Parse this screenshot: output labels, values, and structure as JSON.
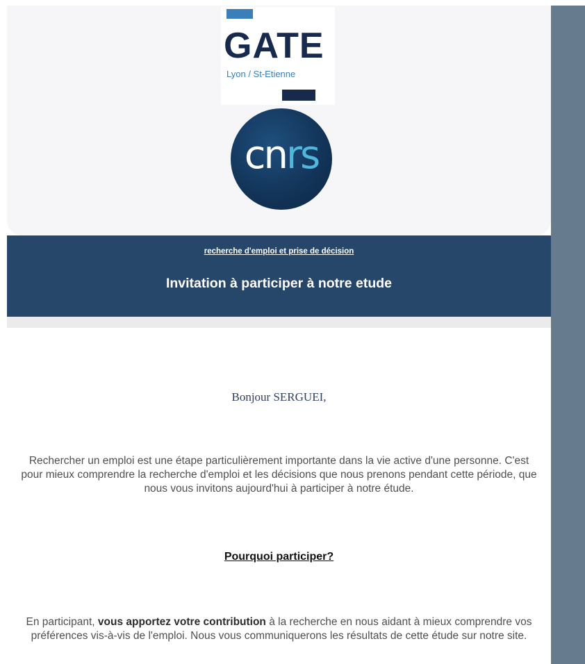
{
  "logos": {
    "gate_word": "GATE",
    "gate_subtitle": "Lyon / St-Etienne",
    "cnrs_part1": "cn",
    "cnrs_part2": "rs"
  },
  "banner": {
    "link_text": "recherche d'emploi et prise de décision",
    "title": "Invitation à participer à notre etude"
  },
  "body": {
    "greeting": "Bonjour SERGUEI,",
    "intro": "Rechercher un emploi est une étape particulièrement importante dans la vie active d'une personne. C'est pour mieux comprendre la recherche d'emploi et les décisions que nous prenons pendant cette période, que nous vous invitons aujourd'hui à participer à notre étude.",
    "section_heading": "Pourquoi participer? ",
    "contribution_before": "En participant, ",
    "contribution_bold": "vous apportez votre contribution",
    "contribution_after": " à la recherche en nous aidant à mieux comprendre vos préférences vis-à-vis de l'emploi. Nous vous communiquerons les résultats de cette étude sur notre site."
  },
  "colors": {
    "banner_bg": "#27476a",
    "side_strip": "#667b8e",
    "gate_navy": "#172a4e",
    "gate_blue": "#3a7fba",
    "cnrs_accent": "#4fb6dc"
  }
}
